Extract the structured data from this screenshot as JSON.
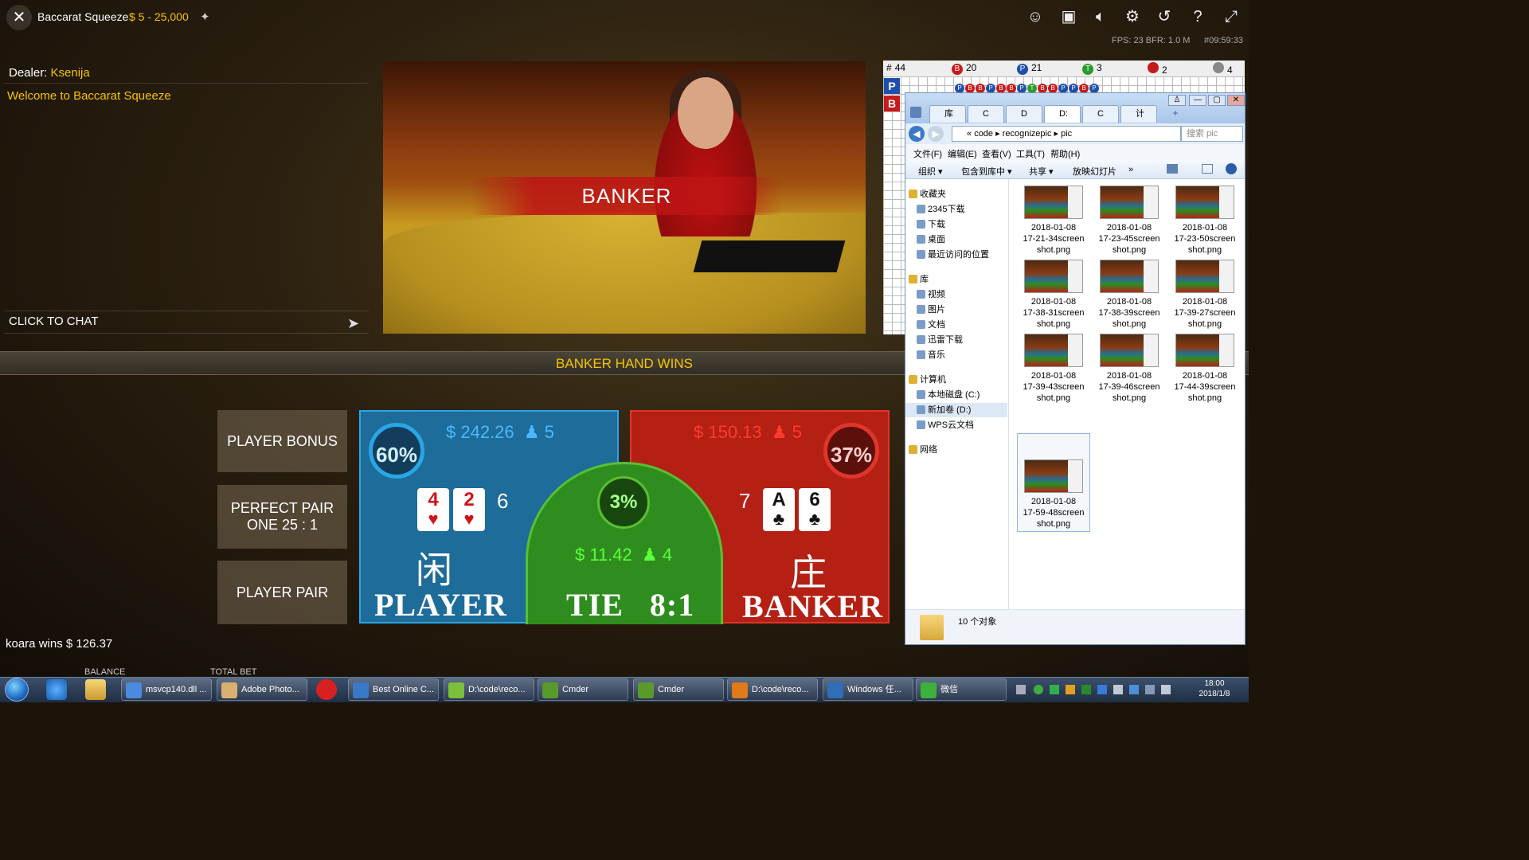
{
  "topbar": {
    "close": "✕",
    "title": "Baccarat Squeeze",
    "limits": "$ 5 - 25,000",
    "pin": "📌",
    "fps": "FPS: 23 BFR: 1.0   M",
    "clock": "#09:59:33"
  },
  "chat": {
    "dealer_label": "Dealer:",
    "dealer_name": "Ksenija",
    "welcome": "Welcome to Baccarat Squeeze",
    "input_label": "CLICK TO CHAT"
  },
  "video": {
    "banner": "BANKER"
  },
  "result": {
    "text": "BANKER HAND WINS"
  },
  "side_bets": {
    "player_bonus": "PLAYER BONUS",
    "perfect_pair_line1": "PERFECT PAIR",
    "perfect_pair_line2": "ONE 25 : 1",
    "player_pair": "PLAYER PAIR"
  },
  "player": {
    "percent": "60%",
    "amount": "$ 242.26",
    "bettors": "5",
    "cards": [
      {
        "rank": "4",
        "suit": "♥"
      },
      {
        "rank": "2",
        "suit": "♥"
      }
    ],
    "total": "6",
    "cn": "闲",
    "label": "PLAYER",
    "color": "#1e6c99"
  },
  "banker": {
    "percent": "37%",
    "amount": "$ 150.13",
    "bettors": "5",
    "cards": [
      {
        "rank": "A",
        "suit": "♣"
      },
      {
        "rank": "6",
        "suit": "♣"
      }
    ],
    "total": "7",
    "cn": "庄",
    "label": "BANKER",
    "color": "#b42014"
  },
  "tie": {
    "percent": "3%",
    "amount": "$ 11.42",
    "bettors": "4",
    "label": "TIE   8:1",
    "color": "#2f8d1f"
  },
  "footer": {
    "win_message": "koara wins $ 126.37",
    "balance_label": "BALANCE",
    "total_bet_label": "TOTAL BET"
  },
  "road": {
    "header": [
      {
        "label": "#",
        "value": "44"
      },
      {
        "label": "B",
        "value": "20"
      },
      {
        "label": "P",
        "value": "21"
      },
      {
        "label": "T",
        "value": "3"
      },
      {
        "label": "",
        "value": "2"
      },
      {
        "label": "",
        "value": "4"
      }
    ],
    "beads": [
      "P",
      "B",
      "B",
      "P",
      "B",
      "B",
      "P",
      "T",
      "B",
      "B",
      "P",
      "P",
      "B",
      "P"
    ],
    "side_p": "P",
    "side_b": "B"
  },
  "explorer": {
    "tabs": [
      "库",
      "C",
      "D",
      "D:",
      "C",
      "计"
    ],
    "path": [
      "code",
      "recognizepic",
      "pic"
    ],
    "search_placeholder": "搜索 pic",
    "menu": [
      "文件(F)",
      "编辑(E)",
      "查看(V)",
      "工具(T)",
      "帮助(H)"
    ],
    "toolbar": [
      "组织 ▾",
      "包含到库中 ▾",
      "共享 ▾",
      "放映幻灯片",
      "»"
    ],
    "nav": [
      {
        "label": "收藏夹",
        "group": true
      },
      {
        "label": "2345下载"
      },
      {
        "label": "下载"
      },
      {
        "label": "桌面"
      },
      {
        "label": "最近访问的位置"
      },
      {
        "label": "库",
        "group": true
      },
      {
        "label": "视频"
      },
      {
        "label": "图片"
      },
      {
        "label": "文档"
      },
      {
        "label": "迅雷下载"
      },
      {
        "label": "音乐"
      },
      {
        "label": "计算机",
        "group": true
      },
      {
        "label": "本地磁盘 (C:)"
      },
      {
        "label": "新加卷 (D:)"
      },
      {
        "label": "WPS云文档"
      },
      {
        "label": "网络",
        "group": true
      }
    ],
    "files": [
      {
        "date": "2018-01-08",
        "name1": "17-21-34screen",
        "name2": "shot.png"
      },
      {
        "date": "2018-01-08",
        "name1": "17-23-45screen",
        "name2": "shot.png"
      },
      {
        "date": "2018-01-08",
        "name1": "17-23-50screen",
        "name2": "shot.png"
      },
      {
        "date": "2018-01-08",
        "name1": "17-38-31screen",
        "name2": "shot.png"
      },
      {
        "date": "2018-01-08",
        "name1": "17-38-39screen",
        "name2": "shot.png"
      },
      {
        "date": "2018-01-08",
        "name1": "17-39-27screen",
        "name2": "shot.png"
      },
      {
        "date": "2018-01-08",
        "name1": "17-39-43screen",
        "name2": "shot.png"
      },
      {
        "date": "2018-01-08",
        "name1": "17-39-46screen",
        "name2": "shot.png"
      },
      {
        "date": "2018-01-08",
        "name1": "17-44-39screen",
        "name2": "shot.png"
      },
      {
        "date": "2018-01-08",
        "name1": "17-59-48screen",
        "name2": "shot.png"
      }
    ],
    "status": "10 个对象"
  },
  "taskbar": {
    "buttons": [
      {
        "label": "msvcp140.dll ...",
        "color": "#4a8be0"
      },
      {
        "label": "Adobe Photo...",
        "color": "#d9b070"
      },
      {
        "label": "Best Online C...",
        "color": "#3a78c8"
      },
      {
        "label": "D:\\code\\reco...",
        "color": "#7bbf3a"
      },
      {
        "label": "Cmder",
        "color": "#5a9a2a"
      },
      {
        "label": "Cmder",
        "color": "#5a9a2a"
      },
      {
        "label": "D:\\code\\reco...",
        "color": "#e07a1a"
      },
      {
        "label": "Windows 任...",
        "color": "#2e6fb8"
      },
      {
        "label": "微信",
        "color": "#3db03d"
      }
    ],
    "time": "18:00",
    "date": "2018/1/8"
  }
}
